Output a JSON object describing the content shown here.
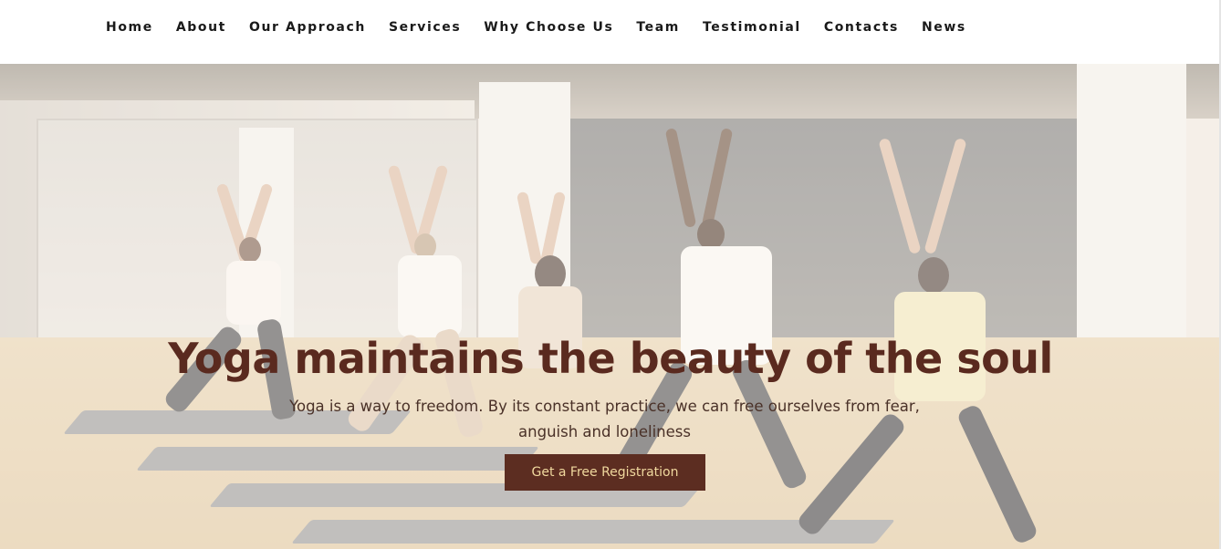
{
  "nav": {
    "items": [
      {
        "label": "Home"
      },
      {
        "label": "About"
      },
      {
        "label": "Our Approach"
      },
      {
        "label": "Services"
      },
      {
        "label": "Why Choose Us"
      },
      {
        "label": "Team"
      },
      {
        "label": "Testimonial"
      },
      {
        "label": "Contacts"
      },
      {
        "label": "News"
      }
    ]
  },
  "hero": {
    "title": "Yoga maintains the beauty of the soul",
    "subtitle": "Yoga is a way to freedom. By its constant practice, we can free ourselves from fear, anguish and loneliness",
    "cta_label": "Get a Free Registration"
  },
  "colors": {
    "title": "#5a2a1f",
    "button_bg": "#5c2d21",
    "button_text": "#f0d89e"
  }
}
